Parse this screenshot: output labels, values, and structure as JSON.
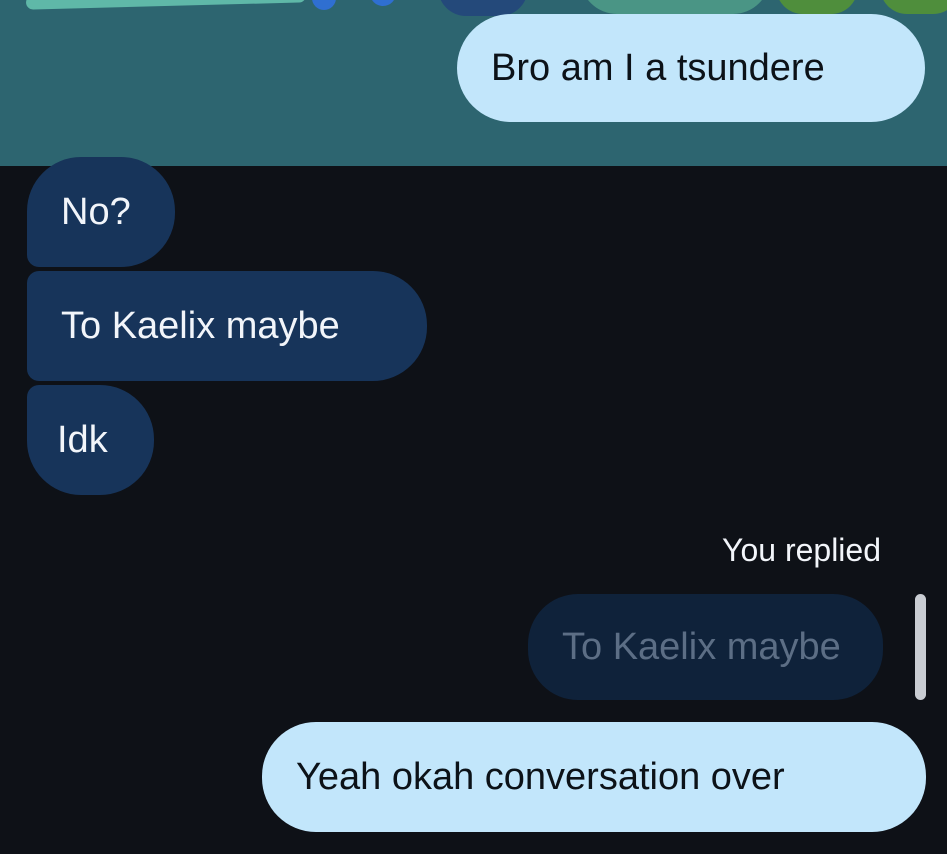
{
  "messages": [
    {
      "direction": "sent",
      "text": "Bro am I a tsundere"
    },
    {
      "direction": "received",
      "text": "No?"
    },
    {
      "direction": "received",
      "text": "To Kaelix maybe"
    },
    {
      "direction": "received",
      "text": "Idk"
    }
  ],
  "reply": {
    "label": "You replied",
    "quoted_text": "To Kaelix maybe",
    "text": "Yeah okah conversation over"
  },
  "colors": {
    "background": "#0e1117",
    "header_band": "#2d6570",
    "sent_bubble": "#c2e6fb",
    "received_bubble": "#17345a",
    "quoted_bubble": "#0f223a"
  }
}
